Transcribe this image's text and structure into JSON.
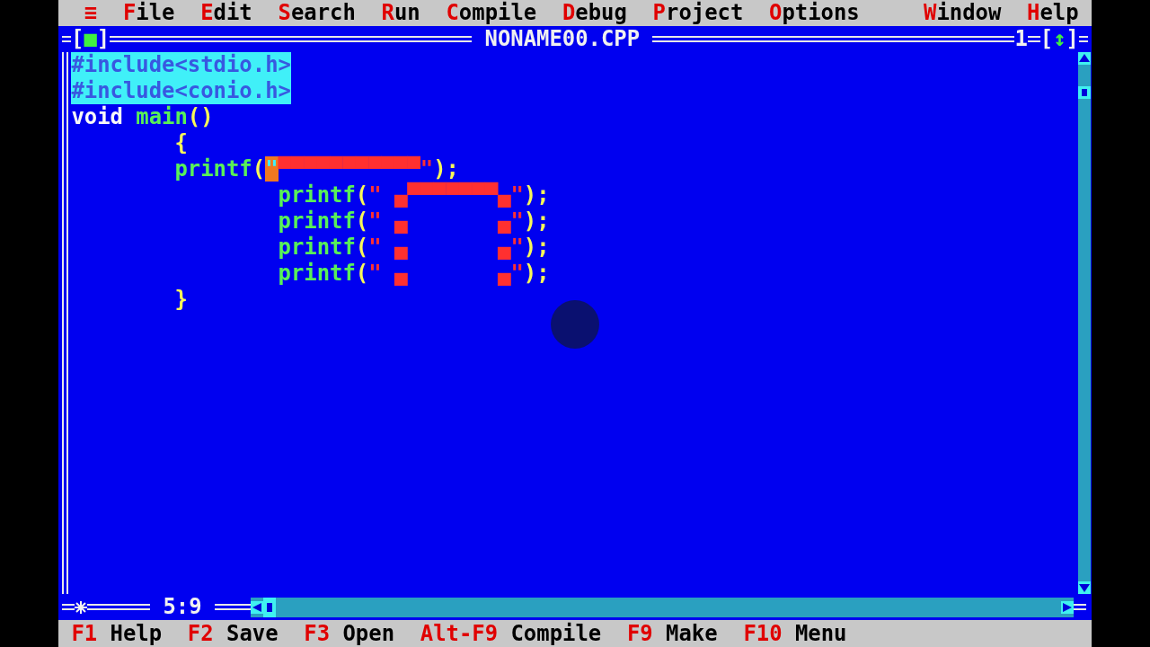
{
  "menu": {
    "system": "≡",
    "items": [
      {
        "hotkey": "F",
        "rest": "ile"
      },
      {
        "hotkey": "E",
        "rest": "dit"
      },
      {
        "hotkey": "S",
        "rest": "earch"
      },
      {
        "hotkey": "R",
        "rest": "un"
      },
      {
        "hotkey": "C",
        "rest": "ompile"
      },
      {
        "hotkey": "D",
        "rest": "ebug"
      },
      {
        "hotkey": "P",
        "rest": "roject"
      },
      {
        "hotkey": "O",
        "rest": "ptions"
      }
    ],
    "right_items": [
      {
        "hotkey": "W",
        "rest": "indow"
      },
      {
        "hotkey": "H",
        "rest": "elp"
      }
    ]
  },
  "editor": {
    "close_box": "[■]",
    "title": "NONAME00.CPP",
    "window_number": "1",
    "zoom_box": "[↕]",
    "modified": true,
    "position": "5:9",
    "lines": [
      {
        "selected": true,
        "segments": [
          {
            "kind": "directive",
            "text": "#include<stdio.h>"
          }
        ]
      },
      {
        "selected": true,
        "segments": [
          {
            "kind": "directive",
            "text": "#include<conio.h>"
          }
        ]
      },
      {
        "selected": false,
        "segments": [
          {
            "kind": "keyword",
            "text": "void "
          },
          {
            "kind": "identifier",
            "text": "main"
          },
          {
            "kind": "symbol",
            "text": "()"
          }
        ]
      },
      {
        "selected": false,
        "segments": [
          {
            "kind": "symbol",
            "text": "        {"
          }
        ]
      },
      {
        "selected": false,
        "segments": [
          {
            "kind": "identifier",
            "text": "        printf"
          },
          {
            "kind": "symbol",
            "text": "("
          },
          {
            "kind": "string",
            "text": "\"",
            "cursor": true
          },
          {
            "kind": "string",
            "text": "▀▀▀▀▀▀▀▀▀▀▀\""
          },
          {
            "kind": "symbol",
            "text": ");"
          }
        ]
      },
      {
        "selected": false,
        "segments": [
          {
            "kind": "identifier",
            "text": "                printf"
          },
          {
            "kind": "symbol",
            "text": "("
          },
          {
            "kind": "string",
            "text": "\" ▄▀▀▀▀▀▀▀▄\""
          },
          {
            "kind": "symbol",
            "text": ");"
          }
        ]
      },
      {
        "selected": false,
        "segments": [
          {
            "kind": "identifier",
            "text": "                printf"
          },
          {
            "kind": "symbol",
            "text": "("
          },
          {
            "kind": "string",
            "text": "\" ▄       ▄\""
          },
          {
            "kind": "symbol",
            "text": ");"
          }
        ]
      },
      {
        "selected": false,
        "segments": [
          {
            "kind": "identifier",
            "text": "                printf"
          },
          {
            "kind": "symbol",
            "text": "("
          },
          {
            "kind": "string",
            "text": "\" ▄       ▄\""
          },
          {
            "kind": "symbol",
            "text": ");"
          }
        ]
      },
      {
        "selected": false,
        "segments": [
          {
            "kind": "identifier",
            "text": "                printf"
          },
          {
            "kind": "symbol",
            "text": "("
          },
          {
            "kind": "string",
            "text": "\" ▄       ▄\""
          },
          {
            "kind": "symbol",
            "text": ");"
          }
        ]
      },
      {
        "selected": false,
        "segments": [
          {
            "kind": "symbol",
            "text": "        }"
          }
        ]
      }
    ]
  },
  "status_bar": [
    {
      "key": "F1",
      "label": "Help"
    },
    {
      "key": "F2",
      "label": "Save"
    },
    {
      "key": "F3",
      "label": "Open"
    },
    {
      "key": "Alt-F9",
      "label": "Compile"
    },
    {
      "key": "F9",
      "label": "Make"
    },
    {
      "key": "F10",
      "label": "Menu"
    }
  ]
}
